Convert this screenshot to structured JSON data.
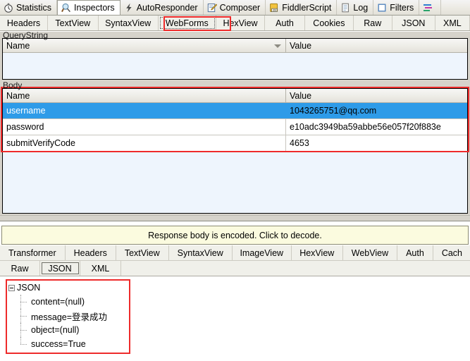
{
  "app": {
    "name": "Fiddler Web Debugger",
    "accent_red": "#ee2b2b",
    "selection_blue": "#2e9be8",
    "notice_bg": "#fbfbdf"
  },
  "main_tabs": [
    {
      "label": "Statistics",
      "icon": "stopwatch-icon",
      "active": false
    },
    {
      "label": "Inspectors",
      "icon": "magnifier-icon",
      "active": true
    },
    {
      "label": "AutoResponder",
      "icon": "lightning-icon",
      "active": false
    },
    {
      "label": "Composer",
      "icon": "pencil-note-icon",
      "active": false
    },
    {
      "label": "FiddlerScript",
      "icon": "js-script-icon",
      "active": false
    },
    {
      "label": "Log",
      "icon": "log-page-icon",
      "active": false
    },
    {
      "label": "Filters",
      "icon": "checkbox-icon",
      "active": false
    },
    {
      "label": "",
      "icon": "timeline-icon",
      "active": false
    }
  ],
  "request_tabs": [
    {
      "label": "Headers",
      "selected": false
    },
    {
      "label": "TextView",
      "selected": false
    },
    {
      "label": "SyntaxView",
      "selected": false
    },
    {
      "label": "WebForms",
      "selected": true
    },
    {
      "label": "HexView",
      "selected": false
    },
    {
      "label": "Auth",
      "selected": false
    },
    {
      "label": "Cookies",
      "selected": false
    },
    {
      "label": "Raw",
      "selected": false
    },
    {
      "label": "JSON",
      "selected": false
    },
    {
      "label": "XML",
      "selected": false
    }
  ],
  "querystring": {
    "caption": "QueryString",
    "columns": [
      "Name",
      "Value"
    ],
    "rows": []
  },
  "body": {
    "caption": "Body",
    "columns": [
      "Name",
      "Value"
    ],
    "rows": [
      {
        "name": "username",
        "value": "1043265751@qq.com",
        "selected": true
      },
      {
        "name": "password",
        "value": "e10adc3949ba59abbe56e057f20f883e",
        "selected": false
      },
      {
        "name": "submitVerifyCode",
        "value": "4653",
        "selected": false
      }
    ]
  },
  "response": {
    "notice": "Response body is encoded. Click to decode.",
    "tabs_row1": [
      {
        "label": "Transformer",
        "selected": false
      },
      {
        "label": "Headers",
        "selected": false
      },
      {
        "label": "TextView",
        "selected": false
      },
      {
        "label": "SyntaxView",
        "selected": false
      },
      {
        "label": "ImageView",
        "selected": false
      },
      {
        "label": "HexView",
        "selected": false
      },
      {
        "label": "WebView",
        "selected": false
      },
      {
        "label": "Auth",
        "selected": false
      },
      {
        "label": "Cach",
        "selected": false
      }
    ],
    "tabs_row2": [
      {
        "label": "Raw",
        "selected": false
      },
      {
        "label": "JSON",
        "selected": true
      },
      {
        "label": "XML",
        "selected": false
      }
    ],
    "json_tree": {
      "root": "JSON",
      "nodes": [
        {
          "text": "content=(null)"
        },
        {
          "text": "message=登录成功"
        },
        {
          "text": "object=(null)"
        },
        {
          "text": "success=True"
        }
      ]
    }
  }
}
